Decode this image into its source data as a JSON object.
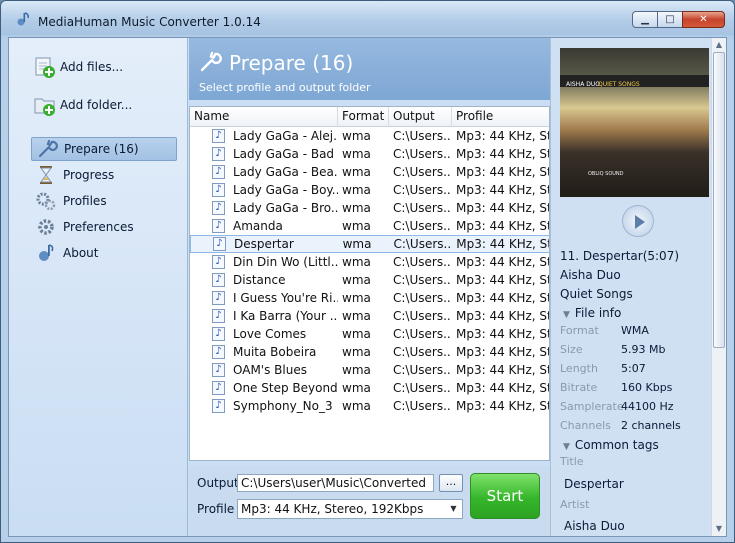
{
  "window": {
    "title": "MediaHuman Music Converter 1.0.14"
  },
  "sidebar": {
    "actions": [
      {
        "label": "Add files..."
      },
      {
        "label": "Add folder..."
      }
    ],
    "nav": [
      {
        "label": "Prepare (16)",
        "icon": "wrench-icon",
        "selected": true
      },
      {
        "label": "Progress",
        "icon": "hourglass-icon"
      },
      {
        "label": "Profiles",
        "icon": "gears-icon"
      },
      {
        "label": "Preferences",
        "icon": "gear-icon"
      },
      {
        "label": "About",
        "icon": "info-icon"
      }
    ]
  },
  "banner": {
    "title": "Prepare (16)",
    "subtitle": "Select profile and output folder"
  },
  "table": {
    "columns": [
      "Name",
      "Format",
      "Output",
      "Profile"
    ],
    "rows": [
      {
        "name": "Lady GaGa - Alej...",
        "format": "wma",
        "output": "C:\\Users...",
        "profile": "Mp3: 44 KHz, St..."
      },
      {
        "name": "Lady GaGa - Bad ...",
        "format": "wma",
        "output": "C:\\Users...",
        "profile": "Mp3: 44 KHz, St..."
      },
      {
        "name": "Lady GaGa - Bea...",
        "format": "wma",
        "output": "C:\\Users...",
        "profile": "Mp3: 44 KHz, St..."
      },
      {
        "name": "Lady GaGa - Boy...",
        "format": "wma",
        "output": "C:\\Users...",
        "profile": "Mp3: 44 KHz, St..."
      },
      {
        "name": "Lady GaGa - Bro...",
        "format": "wma",
        "output": "C:\\Users...",
        "profile": "Mp3: 44 KHz, St..."
      },
      {
        "name": "Amanda",
        "format": "wma",
        "output": "C:\\Users...",
        "profile": "Mp3: 44 KHz, St..."
      },
      {
        "name": "Despertar",
        "format": "wma",
        "output": "C:\\Users...",
        "profile": "Mp3: 44 KHz, St...",
        "selected": true
      },
      {
        "name": "Din Din Wo (Littl...",
        "format": "wma",
        "output": "C:\\Users...",
        "profile": "Mp3: 44 KHz, St..."
      },
      {
        "name": "Distance",
        "format": "wma",
        "output": "C:\\Users...",
        "profile": "Mp3: 44 KHz, St..."
      },
      {
        "name": "I Guess You're Ri...",
        "format": "wma",
        "output": "C:\\Users...",
        "profile": "Mp3: 44 KHz, St..."
      },
      {
        "name": "I Ka Barra (Your ...",
        "format": "wma",
        "output": "C:\\Users...",
        "profile": "Mp3: 44 KHz, St..."
      },
      {
        "name": "Love Comes",
        "format": "wma",
        "output": "C:\\Users...",
        "profile": "Mp3: 44 KHz, St..."
      },
      {
        "name": "Muita Bobeira",
        "format": "wma",
        "output": "C:\\Users...",
        "profile": "Mp3: 44 KHz, St..."
      },
      {
        "name": "OAM's Blues",
        "format": "wma",
        "output": "C:\\Users...",
        "profile": "Mp3: 44 KHz, St..."
      },
      {
        "name": "One Step Beyond",
        "format": "wma",
        "output": "C:\\Users...",
        "profile": "Mp3: 44 KHz, St..."
      },
      {
        "name": "Symphony_No_3",
        "format": "wma",
        "output": "C:\\Users...",
        "profile": "Mp3: 44 KHz, St..."
      }
    ]
  },
  "bottom": {
    "output_label": "Output",
    "output_value": "C:\\Users\\user\\Music\\Converted",
    "browse_label": "...",
    "profile_label": "Profile",
    "profile_value": "Mp3: 44 KHz, Stereo, 192Kbps",
    "start_label": "Start"
  },
  "info": {
    "cover_artist": "AISHA DUO",
    "cover_album": "QUIET SONGS",
    "cover_label": "OBLIQ SOUND",
    "track": "11. Despertar(5:07)",
    "artist": "Aisha Duo",
    "album": "Quiet Songs",
    "file_info_label": "File info",
    "fields": [
      {
        "key": "Format",
        "value": "WMA"
      },
      {
        "key": "Size",
        "value": "5.93 Mb"
      },
      {
        "key": "Length",
        "value": "5:07"
      },
      {
        "key": "Bitrate",
        "value": "160 Kbps"
      },
      {
        "key": "Samplerate",
        "value": "44100 Hz"
      },
      {
        "key": "Channels",
        "value": "2 channels"
      }
    ],
    "common_tags_label": "Common tags",
    "tag_title_key": "Title",
    "tag_title_value": "Despertar",
    "tag_artist_key": "Artist",
    "tag_artist_value": "Aisha Duo"
  },
  "colors": {
    "accent_banner": "#7ea7d4",
    "start_button": "#35b62a",
    "selection": "#eaf3fc"
  }
}
